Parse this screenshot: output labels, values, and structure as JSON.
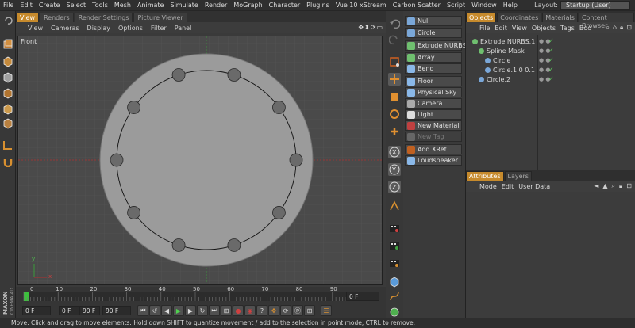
{
  "menubar": {
    "items": [
      "File",
      "Edit",
      "Create",
      "Select",
      "Tools",
      "Mesh",
      "Animate",
      "Simulate",
      "Render",
      "MoGraph",
      "Character",
      "Plugins",
      "Vue 10 xStream",
      "Carbon Scatter",
      "Script",
      "Window",
      "Help"
    ],
    "layout_label": "Layout:",
    "layout_value": "Startup (User)"
  },
  "viewport": {
    "tabs": [
      "View",
      "Renders",
      "Render Settings",
      "Picture Viewer"
    ],
    "active_tab": "View",
    "menu": [
      "View",
      "Cameras",
      "Display",
      "Options",
      "Filter",
      "Panel"
    ],
    "label": "Front",
    "axis_labels": {
      "y": "y",
      "x": "x"
    }
  },
  "timeline": {
    "ticks": [
      "0",
      "10",
      "20",
      "30",
      "40",
      "50",
      "60",
      "70",
      "80",
      "90"
    ],
    "current_frame": "0 F"
  },
  "transport": {
    "start_field": "0 F",
    "range_min": "0 F",
    "range_max": "90 F",
    "end_field": "90 F"
  },
  "object_palette": {
    "items": [
      {
        "label": "Null",
        "icon_color": "#7aa7d8"
      },
      {
        "label": "Circle",
        "icon_color": "#7aa7d8"
      },
      {
        "label": "Extrude NURBS",
        "icon_color": "#6fbf6f"
      },
      {
        "label": "Array",
        "icon_color": "#6fbf6f"
      },
      {
        "label": "Bend",
        "icon_color": "#8ab8e8"
      },
      {
        "label": "Floor",
        "icon_color": "#8ab8e8"
      },
      {
        "label": "Physical Sky",
        "icon_color": "#8ab8e8"
      },
      {
        "label": "Camera",
        "icon_color": "#aaaaaa"
      },
      {
        "label": "Light",
        "icon_color": "#dddddd"
      },
      {
        "label": "New Material",
        "icon_color": "#c04040"
      },
      {
        "label": "New Tag",
        "icon_color": "#666666",
        "disabled": true
      },
      {
        "label": "Add XRef...",
        "icon_color": "#c06020"
      },
      {
        "label": "Loudspeaker",
        "icon_color": "#8ab8e8"
      }
    ]
  },
  "object_manager": {
    "tabs": [
      "Objects",
      "Coordinates",
      "Materials",
      "Content Browser"
    ],
    "active_tab": "Objects",
    "menu": [
      "File",
      "Edit",
      "View",
      "Objects",
      "Tags",
      "Boo"
    ],
    "tree": [
      {
        "name": "Extrude NURBS.1",
        "depth": 0,
        "icon_color": "#6fbf6f"
      },
      {
        "name": "Spline Mask",
        "depth": 1,
        "icon_color": "#6fbf6f"
      },
      {
        "name": "Circle",
        "depth": 2,
        "icon_color": "#7aa7d8"
      },
      {
        "name": "Circle.1 0 0.1",
        "depth": 2,
        "icon_color": "#7aa7d8"
      },
      {
        "name": "Circle.2",
        "depth": 1,
        "icon_color": "#7aa7d8"
      }
    ]
  },
  "attribute_manager": {
    "tabs": [
      "Attributes",
      "Layers"
    ],
    "active_tab": "Attributes",
    "menu": [
      "Mode",
      "Edit",
      "User Data"
    ]
  },
  "statusbar": {
    "text": "Move: Click and drag to move elements. Hold down SHIFT to quantize movement / add to the selection in point mode, CTRL to remove."
  },
  "brand": {
    "logo_text": "MAXON CINEMA 4D"
  },
  "colors": {
    "accent": "#c68a2c",
    "viewport_bg": "#4a4a4a",
    "disc_fill": "#9b9b9b",
    "axis_red": "#b03030",
    "axis_green": "#3a9a3a"
  }
}
